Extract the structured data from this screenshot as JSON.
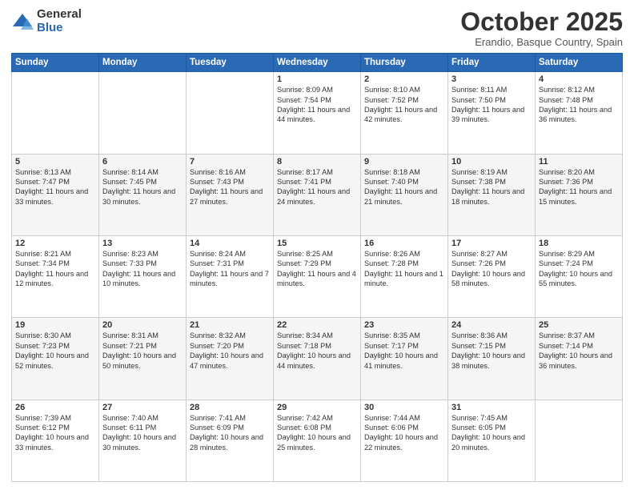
{
  "logo": {
    "general": "General",
    "blue": "Blue"
  },
  "header": {
    "month": "October 2025",
    "location": "Erandio, Basque Country, Spain"
  },
  "weekdays": [
    "Sunday",
    "Monday",
    "Tuesday",
    "Wednesday",
    "Thursday",
    "Friday",
    "Saturday"
  ],
  "weeks": [
    [
      {
        "day": "",
        "info": ""
      },
      {
        "day": "",
        "info": ""
      },
      {
        "day": "",
        "info": ""
      },
      {
        "day": "1",
        "info": "Sunrise: 8:09 AM\nSunset: 7:54 PM\nDaylight: 11 hours and 44 minutes."
      },
      {
        "day": "2",
        "info": "Sunrise: 8:10 AM\nSunset: 7:52 PM\nDaylight: 11 hours and 42 minutes."
      },
      {
        "day": "3",
        "info": "Sunrise: 8:11 AM\nSunset: 7:50 PM\nDaylight: 11 hours and 39 minutes."
      },
      {
        "day": "4",
        "info": "Sunrise: 8:12 AM\nSunset: 7:48 PM\nDaylight: 11 hours and 36 minutes."
      }
    ],
    [
      {
        "day": "5",
        "info": "Sunrise: 8:13 AM\nSunset: 7:47 PM\nDaylight: 11 hours and 33 minutes."
      },
      {
        "day": "6",
        "info": "Sunrise: 8:14 AM\nSunset: 7:45 PM\nDaylight: 11 hours and 30 minutes."
      },
      {
        "day": "7",
        "info": "Sunrise: 8:16 AM\nSunset: 7:43 PM\nDaylight: 11 hours and 27 minutes."
      },
      {
        "day": "8",
        "info": "Sunrise: 8:17 AM\nSunset: 7:41 PM\nDaylight: 11 hours and 24 minutes."
      },
      {
        "day": "9",
        "info": "Sunrise: 8:18 AM\nSunset: 7:40 PM\nDaylight: 11 hours and 21 minutes."
      },
      {
        "day": "10",
        "info": "Sunrise: 8:19 AM\nSunset: 7:38 PM\nDaylight: 11 hours and 18 minutes."
      },
      {
        "day": "11",
        "info": "Sunrise: 8:20 AM\nSunset: 7:36 PM\nDaylight: 11 hours and 15 minutes."
      }
    ],
    [
      {
        "day": "12",
        "info": "Sunrise: 8:21 AM\nSunset: 7:34 PM\nDaylight: 11 hours and 12 minutes."
      },
      {
        "day": "13",
        "info": "Sunrise: 8:23 AM\nSunset: 7:33 PM\nDaylight: 11 hours and 10 minutes."
      },
      {
        "day": "14",
        "info": "Sunrise: 8:24 AM\nSunset: 7:31 PM\nDaylight: 11 hours and 7 minutes."
      },
      {
        "day": "15",
        "info": "Sunrise: 8:25 AM\nSunset: 7:29 PM\nDaylight: 11 hours and 4 minutes."
      },
      {
        "day": "16",
        "info": "Sunrise: 8:26 AM\nSunset: 7:28 PM\nDaylight: 11 hours and 1 minute."
      },
      {
        "day": "17",
        "info": "Sunrise: 8:27 AM\nSunset: 7:26 PM\nDaylight: 10 hours and 58 minutes."
      },
      {
        "day": "18",
        "info": "Sunrise: 8:29 AM\nSunset: 7:24 PM\nDaylight: 10 hours and 55 minutes."
      }
    ],
    [
      {
        "day": "19",
        "info": "Sunrise: 8:30 AM\nSunset: 7:23 PM\nDaylight: 10 hours and 52 minutes."
      },
      {
        "day": "20",
        "info": "Sunrise: 8:31 AM\nSunset: 7:21 PM\nDaylight: 10 hours and 50 minutes."
      },
      {
        "day": "21",
        "info": "Sunrise: 8:32 AM\nSunset: 7:20 PM\nDaylight: 10 hours and 47 minutes."
      },
      {
        "day": "22",
        "info": "Sunrise: 8:34 AM\nSunset: 7:18 PM\nDaylight: 10 hours and 44 minutes."
      },
      {
        "day": "23",
        "info": "Sunrise: 8:35 AM\nSunset: 7:17 PM\nDaylight: 10 hours and 41 minutes."
      },
      {
        "day": "24",
        "info": "Sunrise: 8:36 AM\nSunset: 7:15 PM\nDaylight: 10 hours and 38 minutes."
      },
      {
        "day": "25",
        "info": "Sunrise: 8:37 AM\nSunset: 7:14 PM\nDaylight: 10 hours and 36 minutes."
      }
    ],
    [
      {
        "day": "26",
        "info": "Sunrise: 7:39 AM\nSunset: 6:12 PM\nDaylight: 10 hours and 33 minutes."
      },
      {
        "day": "27",
        "info": "Sunrise: 7:40 AM\nSunset: 6:11 PM\nDaylight: 10 hours and 30 minutes."
      },
      {
        "day": "28",
        "info": "Sunrise: 7:41 AM\nSunset: 6:09 PM\nDaylight: 10 hours and 28 minutes."
      },
      {
        "day": "29",
        "info": "Sunrise: 7:42 AM\nSunset: 6:08 PM\nDaylight: 10 hours and 25 minutes."
      },
      {
        "day": "30",
        "info": "Sunrise: 7:44 AM\nSunset: 6:06 PM\nDaylight: 10 hours and 22 minutes."
      },
      {
        "day": "31",
        "info": "Sunrise: 7:45 AM\nSunset: 6:05 PM\nDaylight: 10 hours and 20 minutes."
      },
      {
        "day": "",
        "info": ""
      }
    ]
  ]
}
